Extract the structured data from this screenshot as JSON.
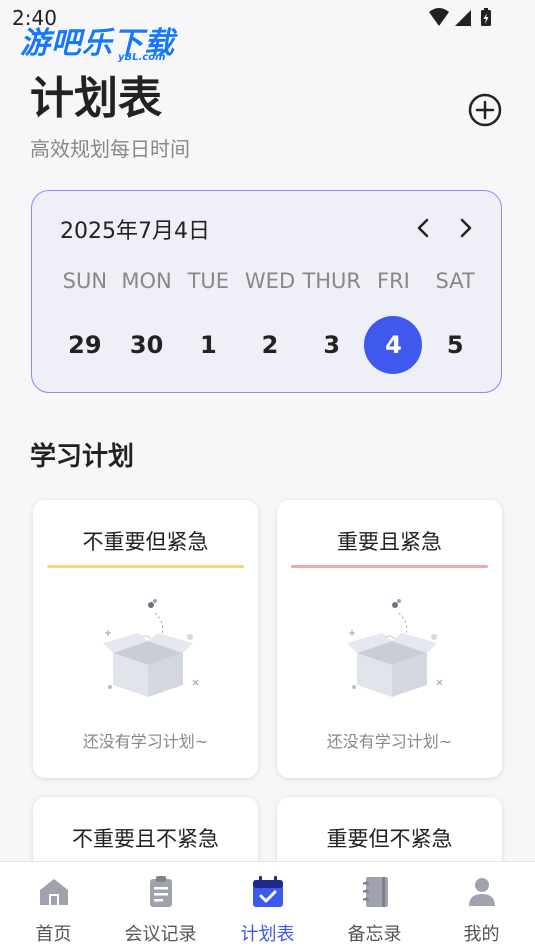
{
  "status_bar": {
    "time": "2:40"
  },
  "watermark": {
    "text": "游吧乐下载",
    "sub": "yBL.com"
  },
  "header": {
    "title": "计划表",
    "subtitle": "高效规划每日时间"
  },
  "calendar": {
    "month_label": "2025年7月4日",
    "weekdays": [
      "SUN",
      "MON",
      "TUE",
      "WED",
      "THUR",
      "FRI",
      "SAT"
    ],
    "days": [
      "29",
      "30",
      "1",
      "2",
      "3",
      "4",
      "5"
    ],
    "selected_day": "4",
    "selected_color": "#3f58ee"
  },
  "section": {
    "title": "学习计划"
  },
  "cards": [
    {
      "title": "不重要但紧急",
      "empty_text": "还没有学习计划~",
      "accent": "#f7d57a"
    },
    {
      "title": "重要且紧急",
      "empty_text": "还没有学习计划~",
      "accent": "#f2a7a7"
    },
    {
      "title": "不重要且不紧急"
    },
    {
      "title": "重要但不紧急"
    }
  ],
  "tabbar": {
    "items": [
      {
        "label": "首页",
        "icon": "home-icon"
      },
      {
        "label": "会议记录",
        "icon": "clipboard-icon"
      },
      {
        "label": "计划表",
        "icon": "calendar-check-icon",
        "active": true
      },
      {
        "label": "备忘录",
        "icon": "notebook-icon"
      },
      {
        "label": "我的",
        "icon": "user-icon"
      }
    ],
    "active_color": "#3f58ee"
  }
}
